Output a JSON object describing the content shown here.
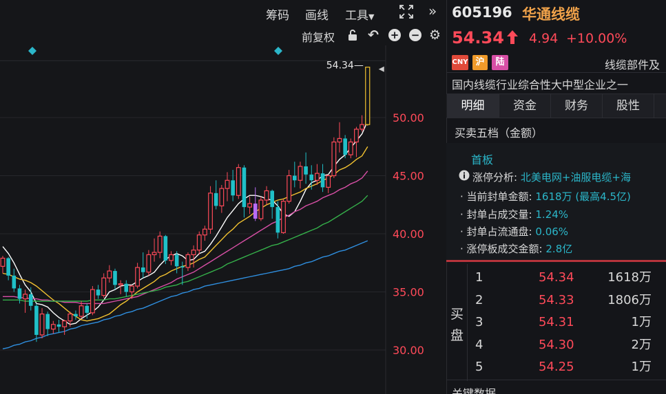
{
  "toolbar": {
    "chip": "筹码",
    "draw": "画线",
    "tools": "工具",
    "adjust": "前复权"
  },
  "stock": {
    "code": "605196",
    "name": "华通线缆",
    "price": "54.34",
    "change": "4.94",
    "change_pct": "+10.00%",
    "tags": [
      "CNY",
      "沪",
      "陆"
    ],
    "industry": "线缆部件及",
    "description": "国内线缆行业综合性大中型企业之一"
  },
  "tabs": [
    "明细",
    "资金",
    "财务",
    "股性"
  ],
  "order_book_title": "买卖五档（金额）",
  "limit_up": {
    "board": "首板",
    "analysis_label": "涨停分析:",
    "analysis_value": "北美电网+油服电缆+海",
    "rows": [
      {
        "label": "当前封单金额:",
        "value": "1618万 (最高4.5亿)"
      },
      {
        "label": "封单占成交量:",
        "value": "1.24%"
      },
      {
        "label": "封单占流通盘:",
        "value": "0.06%"
      },
      {
        "label": "涨停板成交金额:",
        "value": "2.8亿"
      }
    ]
  },
  "buy_side_label": [
    "买",
    "盘"
  ],
  "bids": [
    {
      "level": "1",
      "price": "54.34",
      "amount": "1618万"
    },
    {
      "level": "2",
      "price": "54.33",
      "amount": "1806万"
    },
    {
      "level": "3",
      "price": "54.31",
      "amount": "1万"
    },
    {
      "level": "4",
      "price": "54.30",
      "amount": "2万"
    },
    {
      "level": "5",
      "price": "54.25",
      "amount": "1万"
    }
  ],
  "bottom_label": "关键数据",
  "chart_data": {
    "type": "candlestick",
    "y_ticks": [
      "50.00",
      "45.00",
      "40.00",
      "35.00",
      "30.00"
    ],
    "y_tick_values": [
      50,
      45,
      40,
      35,
      30
    ],
    "last_price_label": "54.34",
    "candles": [
      [
        37.2,
        38.1,
        36.6,
        37.9
      ],
      [
        37.9,
        38.0,
        36.0,
        36.4
      ],
      [
        36.4,
        37.0,
        35.0,
        35.3
      ],
      [
        35.3,
        35.6,
        34.0,
        34.4
      ],
      [
        34.4,
        35.2,
        33.2,
        34.8
      ],
      [
        34.8,
        35.4,
        33.4,
        33.8
      ],
      [
        33.8,
        34.0,
        30.7,
        31.3
      ],
      [
        31.3,
        33.6,
        31.0,
        33.1
      ],
      [
        33.1,
        33.3,
        31.2,
        31.8
      ],
      [
        31.8,
        32.5,
        31.4,
        32.2
      ],
      [
        32.2,
        32.6,
        31.5,
        32.0
      ],
      [
        32.0,
        32.6,
        31.3,
        32.5
      ],
      [
        32.5,
        33.3,
        32.0,
        33.1
      ],
      [
        33.1,
        33.4,
        32.6,
        32.9
      ],
      [
        32.9,
        34.2,
        32.7,
        33.8
      ],
      [
        33.8,
        34.0,
        32.7,
        33.2
      ],
      [
        33.2,
        35.5,
        33.0,
        35.2
      ],
      [
        35.2,
        35.6,
        34.4,
        34.7
      ],
      [
        34.7,
        36.6,
        34.5,
        36.2
      ],
      [
        36.2,
        37.3,
        35.8,
        36.8
      ],
      [
        36.8,
        37.0,
        35.2,
        35.6
      ],
      [
        35.6,
        36.0,
        34.8,
        35.7
      ],
      [
        35.7,
        36.0,
        34.6,
        35.0
      ],
      [
        35.0,
        35.6,
        34.4,
        35.5
      ],
      [
        35.5,
        37.5,
        35.3,
        37.1
      ],
      [
        37.1,
        38.4,
        36.2,
        36.7
      ],
      [
        36.7,
        38.6,
        36.4,
        38.2
      ],
      [
        38.2,
        39.6,
        37.6,
        38.4
      ],
      [
        38.4,
        40.2,
        37.9,
        39.8
      ],
      [
        39.8,
        39.9,
        37.4,
        37.7
      ],
      [
        37.7,
        38.5,
        37.3,
        38.2
      ],
      [
        38.2,
        38.5,
        36.6,
        37.2
      ],
      [
        37.2,
        37.6,
        35.6,
        37.1
      ],
      [
        37.1,
        38.4,
        36.8,
        38.2
      ],
      [
        38.2,
        39.0,
        37.1,
        38.6
      ],
      [
        38.6,
        40.2,
        38.2,
        39.9
      ],
      [
        39.9,
        40.7,
        39.4,
        40.4
      ],
      [
        40.4,
        44.1,
        40.0,
        43.5
      ],
      [
        43.5,
        44.6,
        42.1,
        42.4
      ],
      [
        42.4,
        44.2,
        41.8,
        43.9
      ],
      [
        43.9,
        45.3,
        42.8,
        44.6
      ],
      [
        44.6,
        45.5,
        42.8,
        43.3
      ],
      [
        43.3,
        46.0,
        43.0,
        45.7
      ],
      [
        45.7,
        45.9,
        41.4,
        42.3
      ],
      [
        42.3,
        43.2,
        41.7,
        42.6
      ],
      [
        42.6,
        44.0,
        41.1,
        41.3
      ],
      [
        41.3,
        43.2,
        41.1,
        42.9
      ],
      [
        42.9,
        44.1,
        42.5,
        43.7
      ],
      [
        43.7,
        43.8,
        41.3,
        42.3
      ],
      [
        42.3,
        42.8,
        39.6,
        40.1
      ],
      [
        40.1,
        43.0,
        40.0,
        42.8
      ],
      [
        42.8,
        45.5,
        42.6,
        45.0
      ],
      [
        45.0,
        46.2,
        44.0,
        44.6
      ],
      [
        44.6,
        46.2,
        43.9,
        45.8
      ],
      [
        45.8,
        47.0,
        44.3,
        45.1
      ],
      [
        45.1,
        45.9,
        43.8,
        44.6
      ],
      [
        44.6,
        46.0,
        44.2,
        45.2
      ],
      [
        45.2,
        46.0,
        43.6,
        44.0
      ],
      [
        44.0,
        45.1,
        43.5,
        45.0
      ],
      [
        45.0,
        48.3,
        44.8,
        47.9
      ],
      [
        47.9,
        49.6,
        47.0,
        48.2
      ],
      [
        48.2,
        48.5,
        46.5,
        46.8
      ],
      [
        46.8,
        48.2,
        46.5,
        47.9
      ],
      [
        47.9,
        49.2,
        46.6,
        49.0
      ],
      [
        49.0,
        50.2,
        48.8,
        49.4
      ],
      [
        49.4,
        54.34,
        49.3,
        54.34
      ]
    ],
    "ma_lines": [
      {
        "color": "#ffffff",
        "values": [
          38.9,
          38.3,
          37.5,
          36.5,
          35.6,
          35.0,
          34.0,
          33.9,
          33.7,
          33.2,
          32.8,
          32.5,
          32.2,
          32.3,
          32.7,
          33.0,
          33.3,
          33.7,
          34.3,
          35.0,
          35.2,
          35.5,
          35.6,
          35.6,
          35.9,
          36.2,
          36.4,
          36.7,
          37.3,
          37.8,
          38.1,
          38.3,
          38.1,
          37.7,
          37.8,
          38.3,
          38.5,
          39.1,
          39.8,
          40.6,
          41.4,
          42.0,
          42.6,
          43.0,
          43.3,
          43.3,
          43.2,
          43.0,
          42.9,
          42.4,
          41.7,
          41.5,
          41.9,
          42.8,
          43.8,
          44.4,
          44.6,
          45.0,
          45.1,
          45.8,
          46.4,
          46.8,
          47.4,
          48.0,
          48.6,
          49.7
        ]
      },
      {
        "color": "#f2c230",
        "values": [
          36.6,
          36.5,
          36.3,
          36.1,
          36.0,
          35.8,
          35.5,
          35.1,
          34.7,
          34.3,
          34.0,
          33.6,
          33.2,
          32.9,
          32.6,
          32.5,
          32.6,
          32.7,
          32.9,
          33.1,
          33.5,
          33.9,
          34.2,
          34.6,
          35.0,
          35.3,
          35.6,
          35.9,
          36.3,
          36.5,
          36.8,
          37.0,
          37.2,
          37.3,
          37.5,
          37.8,
          38.0,
          38.5,
          39.0,
          39.5,
          40.0,
          40.4,
          40.9,
          41.2,
          41.5,
          41.9,
          42.2,
          42.5,
          42.7,
          42.9,
          43.0,
          43.2,
          43.4,
          43.6,
          43.9,
          44.1,
          44.3,
          44.6,
          44.8,
          45.1,
          45.5,
          45.7,
          46.0,
          46.4,
          46.7,
          47.5
        ]
      },
      {
        "color": "#d84fa6",
        "values": [
          34.6,
          34.6,
          34.6,
          34.5,
          34.5,
          34.4,
          34.4,
          34.3,
          34.3,
          34.2,
          34.2,
          34.1,
          34.1,
          34.1,
          34.0,
          34.0,
          34.0,
          34.0,
          34.0,
          34.1,
          34.2,
          34.3,
          34.4,
          34.5,
          34.6,
          34.8,
          35.0,
          35.2,
          35.4,
          35.6,
          35.8,
          36.1,
          36.3,
          36.5,
          36.7,
          37.0,
          37.3,
          37.6,
          37.9,
          38.2,
          38.5,
          38.8,
          39.1,
          39.4,
          39.7,
          40.0,
          40.3,
          40.6,
          40.9,
          41.1,
          41.4,
          41.6,
          41.9,
          42.1,
          42.4,
          42.6,
          42.8,
          43.1,
          43.3,
          43.5,
          43.8,
          44.0,
          44.3,
          44.5,
          44.8,
          45.4
        ]
      },
      {
        "color": "#35b04a",
        "values": [
          34.3,
          34.3,
          34.3,
          34.3,
          34.2,
          34.2,
          34.2,
          34.2,
          34.2,
          34.2,
          34.2,
          34.2,
          34.2,
          34.2,
          34.2,
          34.2,
          34.3,
          34.3,
          34.3,
          34.4,
          34.4,
          34.5,
          34.6,
          34.7,
          34.8,
          34.9,
          35.0,
          35.1,
          35.2,
          35.4,
          35.5,
          35.6,
          35.8,
          35.9,
          36.1,
          36.3,
          36.5,
          36.7,
          36.9,
          37.1,
          37.4,
          37.6,
          37.8,
          38.0,
          38.2,
          38.4,
          38.6,
          38.8,
          39.0,
          39.1,
          39.3,
          39.5,
          39.7,
          39.9,
          40.1,
          40.3,
          40.5,
          40.8,
          41.0,
          41.3,
          41.6,
          41.9,
          42.2,
          42.5,
          42.8,
          43.3
        ]
      },
      {
        "color": "#2f8fe0",
        "values": [
          30.1,
          30.2,
          30.4,
          30.5,
          30.7,
          30.8,
          31.0,
          31.1,
          31.3,
          31.4,
          31.5,
          31.6,
          31.8,
          31.9,
          32.1,
          32.2,
          32.3,
          32.4,
          32.6,
          32.7,
          32.9,
          33.0,
          33.2,
          33.3,
          33.5,
          33.6,
          33.8,
          34.0,
          34.2,
          34.4,
          34.6,
          34.7,
          34.9,
          35.0,
          35.2,
          35.3,
          35.5,
          35.6,
          35.7,
          35.8,
          35.9,
          36.0,
          36.1,
          36.2,
          36.3,
          36.4,
          36.5,
          36.6,
          36.7,
          36.8,
          36.9,
          37.0,
          37.2,
          37.3,
          37.5,
          37.6,
          37.8,
          38.0,
          38.1,
          38.3,
          38.5,
          38.6,
          38.8,
          39.0,
          39.2,
          39.4
        ]
      }
    ],
    "colors": {
      "up": "#ff4a59",
      "down": "#20c0c8",
      "today": "#f2c230",
      "purple": "#b86bf7"
    }
  }
}
